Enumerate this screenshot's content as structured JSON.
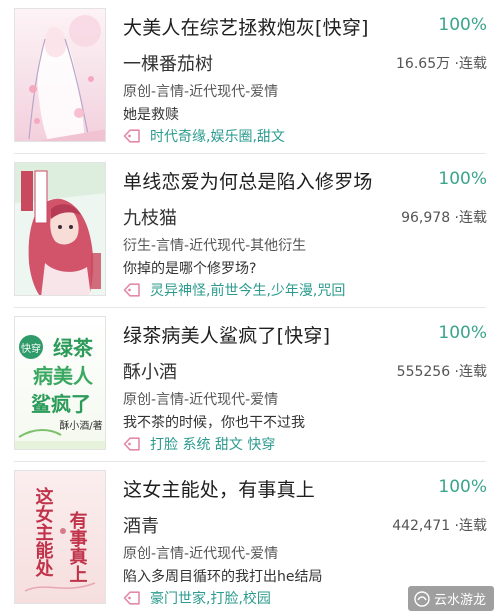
{
  "books": [
    {
      "title": "大美人在综艺拯救炮灰[快穿]",
      "progress": "100%",
      "author": "一棵番茄树",
      "stats": "16.65万 ·连载",
      "category": "原创-言情-近代现代-爱情",
      "summary": "她是救赎",
      "tags": "时代奇缘,娱乐圈,甜文",
      "cover_icon": "pink-illustration-cover"
    },
    {
      "title": "单线恋爱为何总是陷入修罗场",
      "progress": "100%",
      "author": "九枝猫",
      "stats": "96,978 ·连载",
      "category": "衍生-言情-近代现代-其他衍生",
      "summary": "你掉的是哪个修罗场?",
      "tags": "灵异神怪,前世今生,少年漫,咒回",
      "cover_icon": "red-hair-character-cover"
    },
    {
      "title": "绿茶病美人鲨疯了[快穿]",
      "progress": "100%",
      "author": "酥小酒",
      "stats": "555256 ·连载",
      "category": "原创-言情-近代现代-爱情",
      "summary": "我不茶的时候，你也干不过我",
      "tags": "打脸 系统 甜文 快穿",
      "cover_icon": "green-text-cover",
      "cover_text": {
        "badge": "快穿",
        "line1": "绿茶",
        "line2": "病美人",
        "line3": "鲨疯了",
        "author_sig": "酥小酒/著"
      }
    },
    {
      "title": "这女主能处，有事真上",
      "progress": "100%",
      "author": "酒青",
      "stats": "442,471 ·连载",
      "category": "原创-言情-近代现代-爱情",
      "summary": "陷入多周目循环的我打出he结局",
      "tags": "豪门世家,打脸,校园",
      "cover_icon": "calligraphy-cover",
      "cover_text": {
        "left": "这女主能处",
        "right": "有事真上"
      }
    }
  ],
  "watermark": "云水游龙",
  "colors": {
    "accent": "#3aa58c",
    "tag": "#2c9b8e",
    "divider": "#e7e7e7"
  }
}
